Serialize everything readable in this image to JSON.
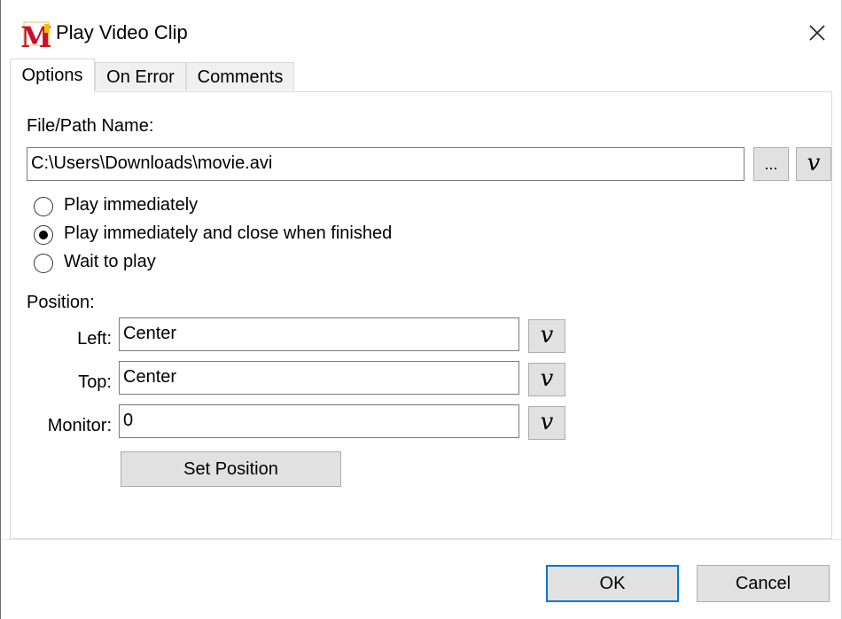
{
  "window": {
    "title": "Play Video Clip",
    "app_icon_letter": "M",
    "close_glyph": "✕"
  },
  "tabs": [
    {
      "label": "Options",
      "active": true
    },
    {
      "label": "On Error",
      "active": false
    },
    {
      "label": "Comments",
      "active": false
    }
  ],
  "file": {
    "label": "File/Path Name:",
    "value": "C:\\Users\\Downloads\\movie.avi",
    "browse_label": "...",
    "variable_label": "v"
  },
  "play_mode": {
    "options": [
      {
        "label": "Play immediately",
        "selected": false
      },
      {
        "label": "Play immediately and close when finished",
        "selected": true
      },
      {
        "label": "Wait to play",
        "selected": false
      }
    ]
  },
  "position": {
    "label": "Position:",
    "left": {
      "label": "Left:",
      "value": "Center",
      "variable_label": "v"
    },
    "top": {
      "label": "Top:",
      "value": "Center",
      "variable_label": "v"
    },
    "monitor": {
      "label": "Monitor:",
      "value": "0",
      "variable_label": "v"
    },
    "set_button_label": "Set Position"
  },
  "footer": {
    "ok_label": "OK",
    "cancel_label": "Cancel"
  },
  "colors": {
    "accent": "#0078d7",
    "icon_red": "#c8102e",
    "button_bg": "#e1e1e1"
  }
}
